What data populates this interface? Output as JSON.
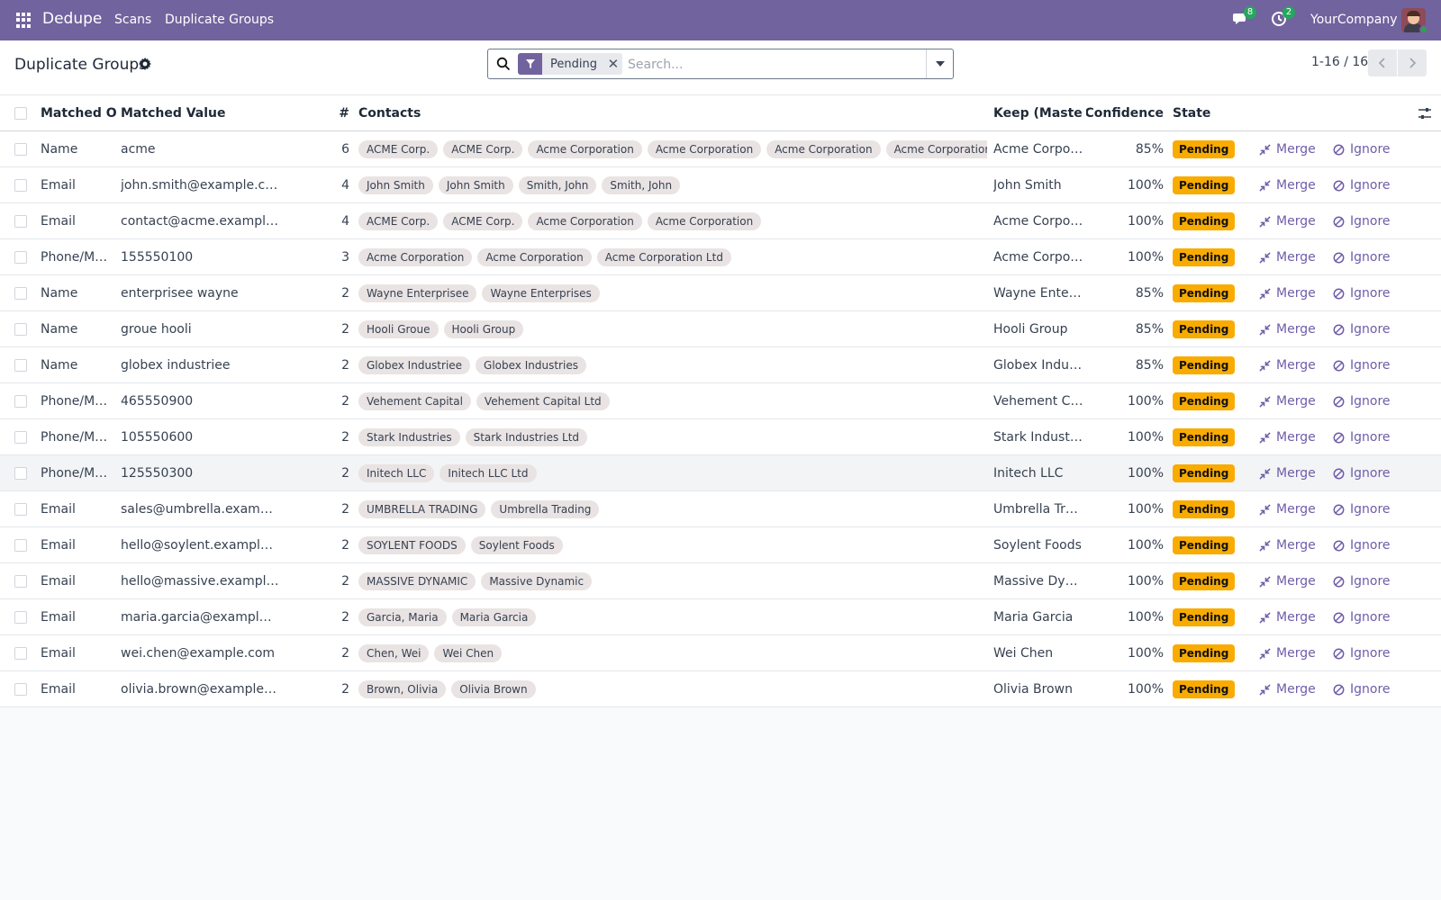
{
  "navbar": {
    "app_name": "Dedupe",
    "menus": [
      "Scans",
      "Duplicate Groups"
    ],
    "messages_count": "8",
    "activities_count": "2",
    "company": "YourCompany"
  },
  "control": {
    "title": "Duplicate Groups",
    "facet": "Pending",
    "search_placeholder": "Search...",
    "pager": "1-16 / 16"
  },
  "columns": {
    "matched_on": "Matched On",
    "matched_value": "Matched Value",
    "count": "#",
    "contacts": "Contacts",
    "keep": "Keep (Master)",
    "confidence": "Confidence",
    "state": "State"
  },
  "actions": {
    "merge": "Merge",
    "ignore": "Ignore"
  },
  "colors": {
    "navbar": "#71639e",
    "pending_badge": "#f9ab00",
    "action_link": "#6f5da8",
    "tag": "#e9e3e3"
  },
  "rows": [
    {
      "matched_on": "Name",
      "value": "acme",
      "count": "6",
      "contacts": [
        "ACME Corp.",
        "ACME Corp.",
        "Acme Corporation",
        "Acme Corporation",
        "Acme Corporation",
        "Acme Corporation Ltd"
      ],
      "keep": "Acme Corpor…",
      "confidence": "85%",
      "state": "Pending"
    },
    {
      "matched_on": "Email",
      "value": "john.smith@example.com",
      "count": "4",
      "contacts": [
        "John Smith",
        "John Smith",
        "Smith, John",
        "Smith, John"
      ],
      "keep": "John Smith",
      "confidence": "100%",
      "state": "Pending"
    },
    {
      "matched_on": "Email",
      "value": "contact@acme.example.…",
      "count": "4",
      "contacts": [
        "ACME Corp.",
        "ACME Corp.",
        "Acme Corporation",
        "Acme Corporation"
      ],
      "keep": "Acme Corpor…",
      "confidence": "100%",
      "state": "Pending"
    },
    {
      "matched_on": "Phone/M…",
      "value": "155550100",
      "count": "3",
      "contacts": [
        "Acme Corporation",
        "Acme Corporation",
        "Acme Corporation Ltd"
      ],
      "keep": "Acme Corpor…",
      "confidence": "100%",
      "state": "Pending"
    },
    {
      "matched_on": "Name",
      "value": "enterprisee wayne",
      "count": "2",
      "contacts": [
        "Wayne Enterprisee",
        "Wayne Enterprises"
      ],
      "keep": "Wayne Enter…",
      "confidence": "85%",
      "state": "Pending"
    },
    {
      "matched_on": "Name",
      "value": "groue hooli",
      "count": "2",
      "contacts": [
        "Hooli Groue",
        "Hooli Group"
      ],
      "keep": "Hooli Group",
      "confidence": "85%",
      "state": "Pending"
    },
    {
      "matched_on": "Name",
      "value": "globex industriee",
      "count": "2",
      "contacts": [
        "Globex Industriee",
        "Globex Industries"
      ],
      "keep": "Globex Indus…",
      "confidence": "85%",
      "state": "Pending"
    },
    {
      "matched_on": "Phone/M…",
      "value": "465550900",
      "count": "2",
      "contacts": [
        "Vehement Capital",
        "Vehement Capital Ltd"
      ],
      "keep": "Vehement Ca…",
      "confidence": "100%",
      "state": "Pending"
    },
    {
      "matched_on": "Phone/M…",
      "value": "105550600",
      "count": "2",
      "contacts": [
        "Stark Industries",
        "Stark Industries Ltd"
      ],
      "keep": "Stark Industries",
      "confidence": "100%",
      "state": "Pending"
    },
    {
      "matched_on": "Phone/M…",
      "value": "125550300",
      "count": "2",
      "contacts": [
        "Initech LLC",
        "Initech LLC Ltd"
      ],
      "keep": "Initech LLC",
      "confidence": "100%",
      "state": "Pending"
    },
    {
      "matched_on": "Email",
      "value": "sales@umbrella.example…",
      "count": "2",
      "contacts": [
        "UMBRELLA TRADING",
        "Umbrella Trading"
      ],
      "keep": "Umbrella Tra…",
      "confidence": "100%",
      "state": "Pending"
    },
    {
      "matched_on": "Email",
      "value": "hello@soylent.example.c…",
      "count": "2",
      "contacts": [
        "SOYLENT FOODS",
        "Soylent Foods"
      ],
      "keep": "Soylent Foods",
      "confidence": "100%",
      "state": "Pending"
    },
    {
      "matched_on": "Email",
      "value": "hello@massive.example.…",
      "count": "2",
      "contacts": [
        "MASSIVE DYNAMIC",
        "Massive Dynamic"
      ],
      "keep": "Massive Dyna…",
      "confidence": "100%",
      "state": "Pending"
    },
    {
      "matched_on": "Email",
      "value": "maria.garcia@example.c…",
      "count": "2",
      "contacts": [
        "Garcia, Maria",
        "Maria Garcia"
      ],
      "keep": "Maria Garcia",
      "confidence": "100%",
      "state": "Pending"
    },
    {
      "matched_on": "Email",
      "value": "wei.chen@example.com",
      "count": "2",
      "contacts": [
        "Chen, Wei",
        "Wei Chen"
      ],
      "keep": "Wei Chen",
      "confidence": "100%",
      "state": "Pending"
    },
    {
      "matched_on": "Email",
      "value": "olivia.brown@example.c…",
      "count": "2",
      "contacts": [
        "Brown, Olivia",
        "Olivia Brown"
      ],
      "keep": "Olivia Brown",
      "confidence": "100%",
      "state": "Pending"
    }
  ]
}
